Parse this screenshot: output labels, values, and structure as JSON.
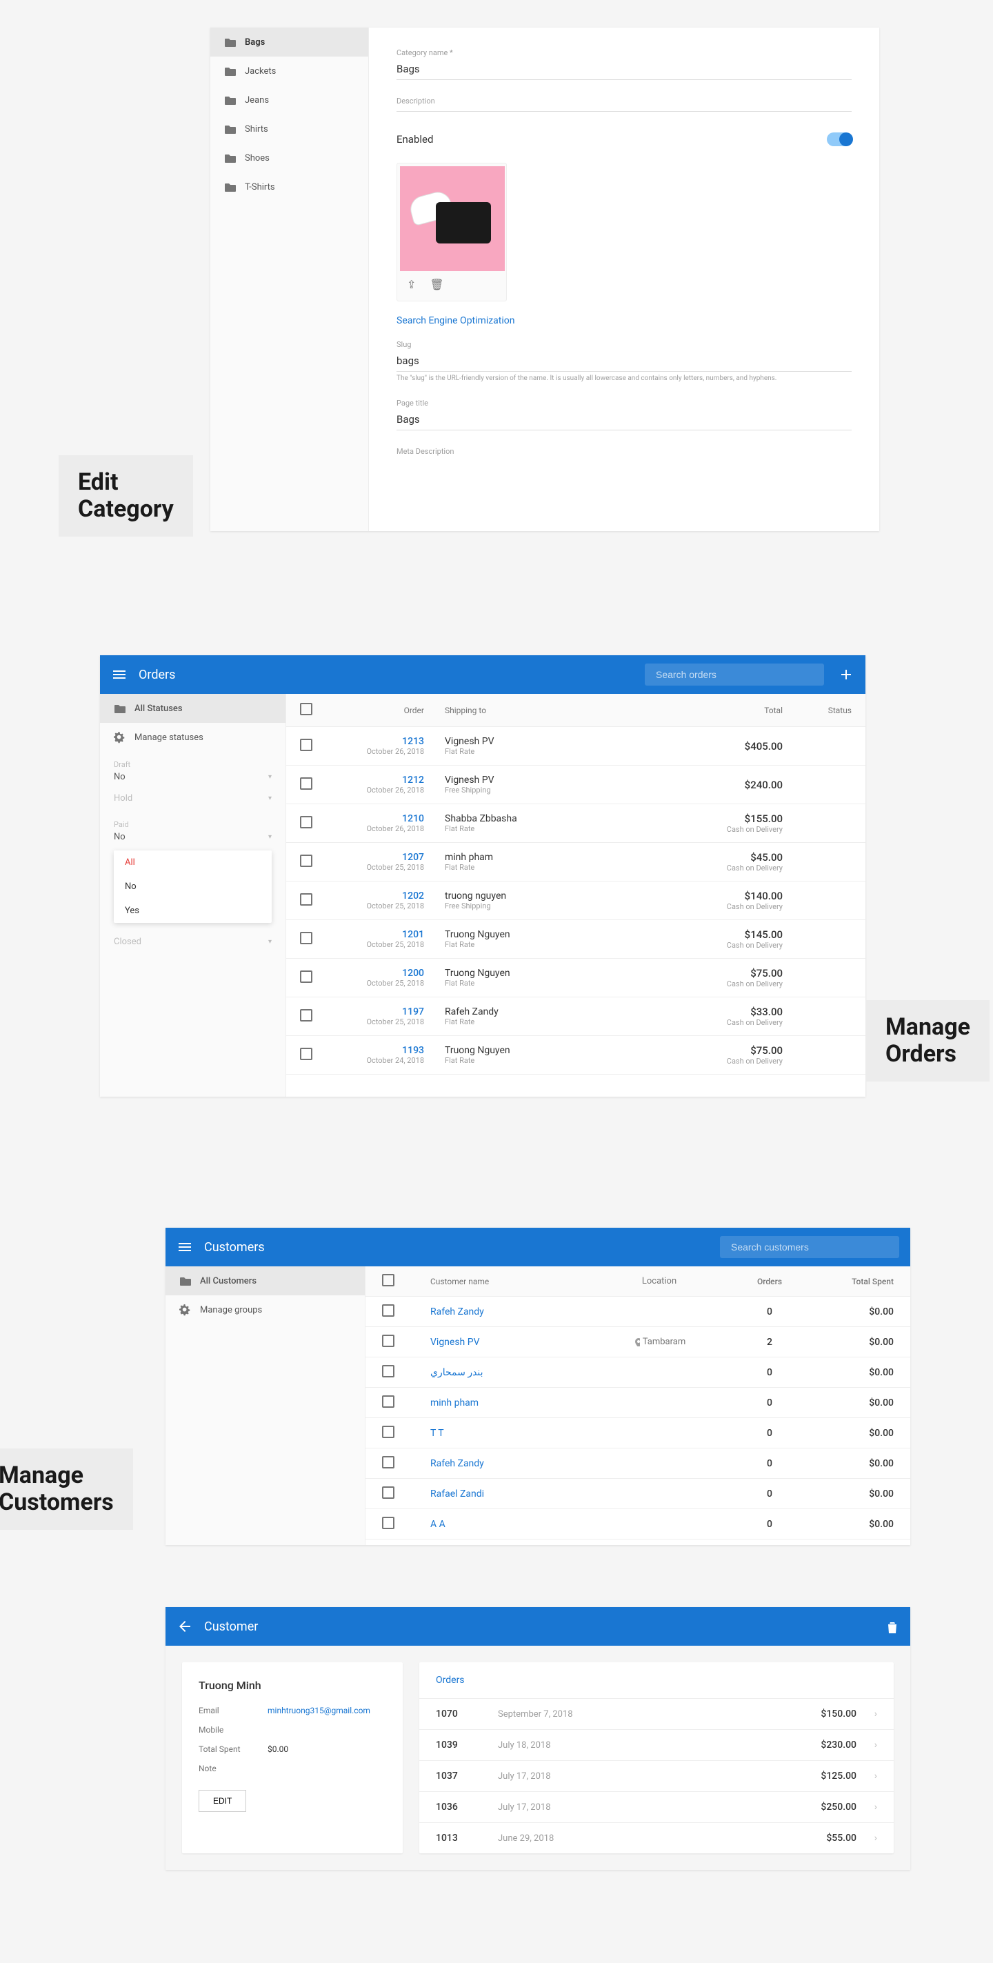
{
  "captions": {
    "edit_category": "Edit\nCategory",
    "manage_orders": "Manage\nOrders",
    "manage_customers": "Manage\nCustomers"
  },
  "edit_category": {
    "sidebar": [
      {
        "label": "Bags",
        "active": true
      },
      {
        "label": "Jackets"
      },
      {
        "label": "Jeans"
      },
      {
        "label": "Shirts"
      },
      {
        "label": "Shoes"
      },
      {
        "label": "T-Shirts"
      }
    ],
    "form": {
      "name_label": "Category name *",
      "name_value": "Bags",
      "desc_label": "Description",
      "enabled_label": "Enabled",
      "seo_link": "Search Engine Optimization",
      "slug_label": "Slug",
      "slug_value": "bags",
      "slug_helper": "The \"slug\" is the URL-friendly version of the name. It is usually all lowercase and contains only letters, numbers, and hyphens.",
      "pagetitle_label": "Page title",
      "pagetitle_value": "Bags",
      "metadesc_label": "Meta Description"
    }
  },
  "orders": {
    "title": "Orders",
    "search_placeholder": "Search orders",
    "sidebar": {
      "all_statuses": "All Statuses",
      "manage_statuses": "Manage statuses",
      "filters": {
        "draft_label": "Draft",
        "draft_value": "No",
        "hold_label": "Hold",
        "paid_label": "Paid",
        "paid_value": "No",
        "paid_options": [
          "All",
          "No",
          "Yes"
        ],
        "closed_label": "Closed"
      }
    },
    "columns": {
      "order": "Order",
      "shipping": "Shipping to",
      "total": "Total",
      "status": "Status"
    },
    "rows": [
      {
        "num": "1213",
        "date": "October 26, 2018",
        "name": "Vignesh PV",
        "ship": "Flat Rate",
        "total": "$405.00",
        "pay": ""
      },
      {
        "num": "1212",
        "date": "October 26, 2018",
        "name": "Vignesh PV",
        "ship": "Free Shipping",
        "total": "$240.00",
        "pay": ""
      },
      {
        "num": "1210",
        "date": "October 26, 2018",
        "name": "Shabba Zbbasha",
        "ship": "Flat Rate",
        "total": "$155.00",
        "pay": "Cash on Delivery"
      },
      {
        "num": "1207",
        "date": "October 25, 2018",
        "name": "minh pham",
        "ship": "Flat Rate",
        "total": "$45.00",
        "pay": "Cash on Delivery"
      },
      {
        "num": "1202",
        "date": "October 25, 2018",
        "name": "truong nguyen",
        "ship": "Free Shipping",
        "total": "$140.00",
        "pay": "Cash on Delivery"
      },
      {
        "num": "1201",
        "date": "October 25, 2018",
        "name": "Truong Nguyen",
        "ship": "Flat Rate",
        "total": "$145.00",
        "pay": "Cash on Delivery"
      },
      {
        "num": "1200",
        "date": "October 25, 2018",
        "name": "Truong Nguyen",
        "ship": "Flat Rate",
        "total": "$75.00",
        "pay": "Cash on Delivery"
      },
      {
        "num": "1197",
        "date": "October 25, 2018",
        "name": "Rafeh Zandy",
        "ship": "Flat Rate",
        "total": "$33.00",
        "pay": "Cash on Delivery"
      },
      {
        "num": "1193",
        "date": "October 24, 2018",
        "name": "Truong Nguyen",
        "ship": "Flat Rate",
        "total": "$75.00",
        "pay": "Cash on Delivery"
      }
    ]
  },
  "customers": {
    "title": "Customers",
    "search_placeholder": "Search customers",
    "sidebar": {
      "all": "All Customers",
      "manage": "Manage groups"
    },
    "columns": {
      "name": "Customer name",
      "location": "Location",
      "orders": "Orders",
      "spent": "Total Spent"
    },
    "rows": [
      {
        "name": "Rafeh Zandy",
        "location": "",
        "orders": "0",
        "spent": "$0.00"
      },
      {
        "name": "Vignesh PV",
        "location": "Tambaram",
        "orders": "2",
        "spent": "$0.00"
      },
      {
        "name": "بندر سمحاري",
        "location": "",
        "orders": "0",
        "spent": "$0.00"
      },
      {
        "name": "minh pham",
        "location": "",
        "orders": "0",
        "spent": "$0.00"
      },
      {
        "name": "T T",
        "location": "",
        "orders": "0",
        "spent": "$0.00"
      },
      {
        "name": "Rafeh Zandy",
        "location": "",
        "orders": "0",
        "spent": "$0.00"
      },
      {
        "name": "Rafael Zandi",
        "location": "",
        "orders": "0",
        "spent": "$0.00"
      },
      {
        "name": "A A",
        "location": "",
        "orders": "0",
        "spent": "$0.00"
      }
    ]
  },
  "customer_detail": {
    "title": "Customer",
    "name": "Truong Minh",
    "fields": {
      "email_label": "Email",
      "email_value": "minhtruong315@gmail.com",
      "mobile_label": "Mobile",
      "mobile_value": "",
      "spent_label": "Total Spent",
      "spent_value": "$0.00",
      "note_label": "Note",
      "note_value": ""
    },
    "edit_btn": "EDIT",
    "orders_head": "Orders",
    "orders": [
      {
        "num": "1070",
        "date": "September 7, 2018",
        "amount": "$150.00"
      },
      {
        "num": "1039",
        "date": "July 18, 2018",
        "amount": "$230.00"
      },
      {
        "num": "1037",
        "date": "July 17, 2018",
        "amount": "$125.00"
      },
      {
        "num": "1036",
        "date": "July 17, 2018",
        "amount": "$250.00"
      },
      {
        "num": "1013",
        "date": "June 29, 2018",
        "amount": "$55.00"
      }
    ]
  }
}
